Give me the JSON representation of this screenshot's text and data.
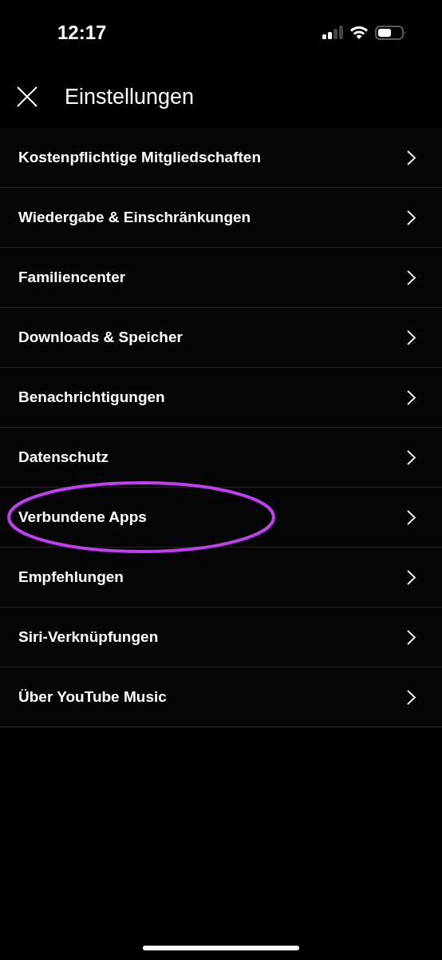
{
  "status_bar": {
    "time": "12:17"
  },
  "header": {
    "title": "Einstellungen"
  },
  "items": [
    {
      "label": "Kostenpflichtige Mitgliedschaften",
      "highlighted": false
    },
    {
      "label": "Wiedergabe & Einschränkungen",
      "highlighted": false
    },
    {
      "label": "Familiencenter",
      "highlighted": false
    },
    {
      "label": "Downloads & Speicher",
      "highlighted": false
    },
    {
      "label": "Benachrichtigungen",
      "highlighted": false
    },
    {
      "label": "Datenschutz",
      "highlighted": false
    },
    {
      "label": "Verbundene Apps",
      "highlighted": true
    },
    {
      "label": "Empfehlungen",
      "highlighted": false
    },
    {
      "label": "Siri-Verknüpfungen",
      "highlighted": false
    },
    {
      "label": "Über YouTube Music",
      "highlighted": false
    }
  ]
}
